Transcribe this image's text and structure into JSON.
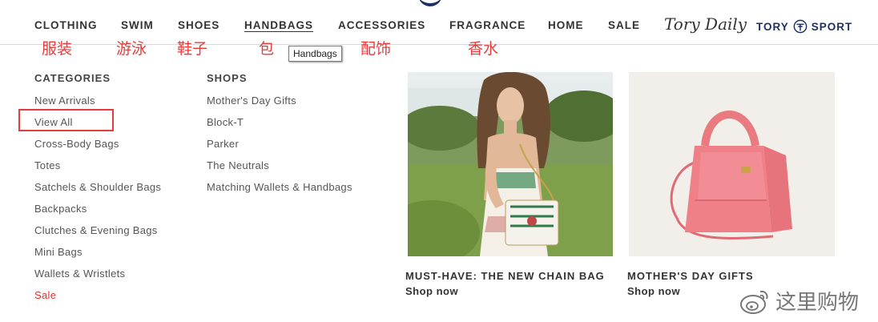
{
  "nav": {
    "items": [
      "CLOTHING",
      "SWIM",
      "SHOES",
      "HANDBAGS",
      "ACCESSORIES",
      "FRAGRANCE",
      "HOME",
      "SALE"
    ],
    "active": "HANDBAGS",
    "brand_daily": "Tory Daily",
    "brand_sport_left": "TORY",
    "brand_sport_right": "SPORT",
    "colors": {
      "sport_blue": "#1e2f66"
    }
  },
  "annotations": {
    "clothing": "服装",
    "swim": "游泳",
    "shoes": "鞋子",
    "handbags": "包",
    "accessories": "配饰",
    "fragrance": "香水",
    "color": "#e53c3c"
  },
  "tooltip": "Handbags",
  "categories": {
    "title": "CATEGORIES",
    "items": [
      "New Arrivals",
      "View All",
      "Cross-Body Bags",
      "Totes",
      "Satchels & Shoulder Bags",
      "Backpacks",
      "Clutches & Evening Bags",
      "Mini Bags",
      "Wallets & Wristlets",
      "Sale"
    ],
    "highlighted": "View All"
  },
  "shops": {
    "title": "SHOPS",
    "items": [
      "Mother's Day Gifts",
      "Block-T",
      "Parker",
      "The Neutrals",
      "Matching Wallets & Handbags"
    ]
  },
  "promos": [
    {
      "title": "MUST-HAVE: THE NEW CHAIN BAG",
      "cta": "Shop now"
    },
    {
      "title": "MOTHER'S DAY GIFTS",
      "cta": "Shop now"
    }
  ],
  "watermark": "这里购物"
}
